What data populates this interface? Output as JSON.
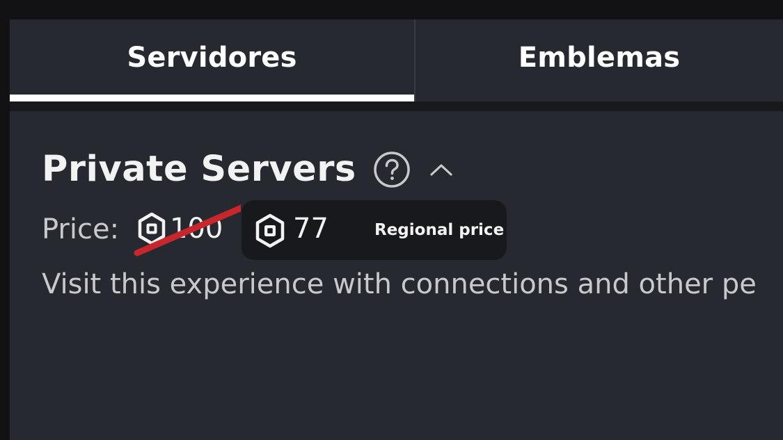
{
  "tabs": [
    {
      "label": "Servidores",
      "active": true
    },
    {
      "label": "Emblemas",
      "active": false
    }
  ],
  "section": {
    "title": "Private Servers",
    "help_icon": "question-circle-icon",
    "collapse_icon": "chevron-up-icon"
  },
  "price": {
    "label": "Price:",
    "currency_icon": "robux-icon",
    "original_value": "100",
    "regional_value": "77",
    "regional_label": "Regional price",
    "strike_color": "#c8262d"
  },
  "description": "Visit this experience with connections and other pe",
  "colors": {
    "background": "#121215",
    "panel": "#272930",
    "pill": "#18191d",
    "text": "#ffffff",
    "muted_text": "#c8c9cc"
  }
}
